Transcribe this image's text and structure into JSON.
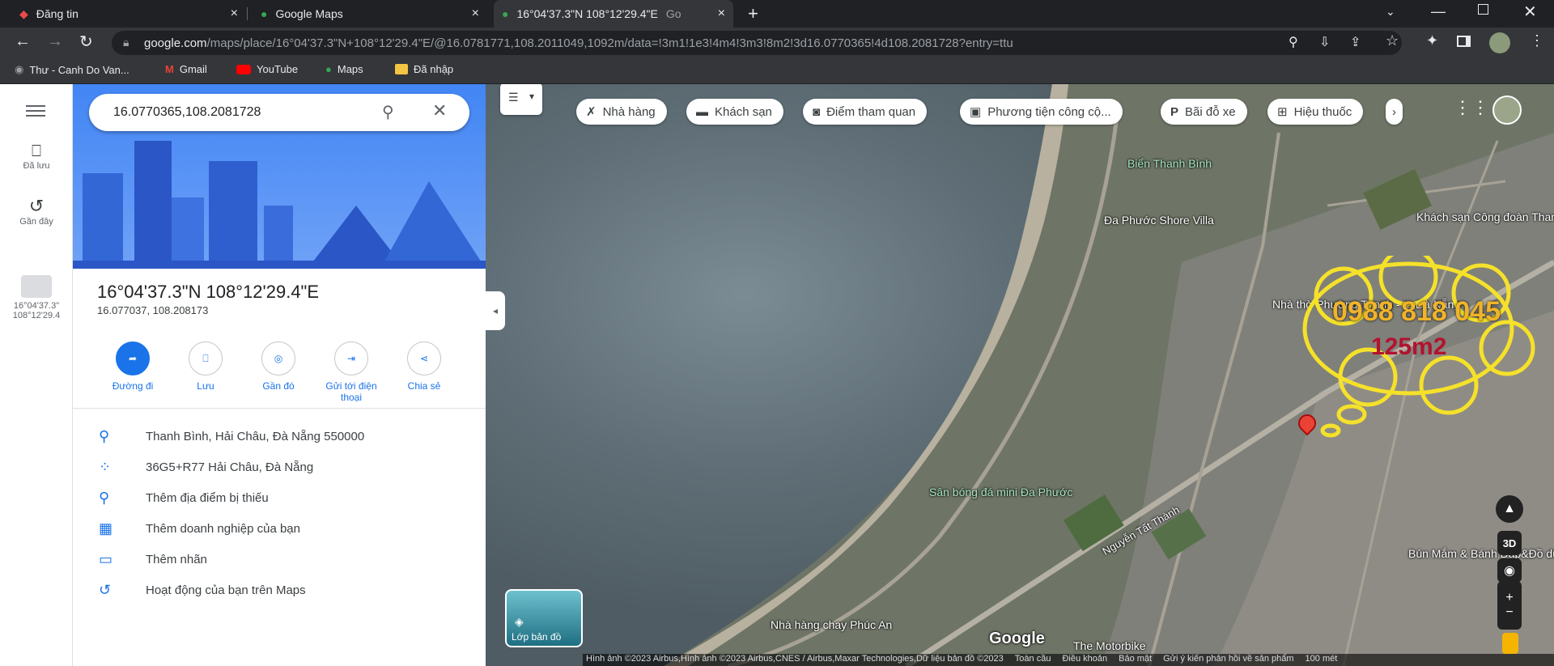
{
  "tabs": [
    {
      "title": "Đăng tin",
      "close": "×"
    },
    {
      "title": "Google Maps",
      "close": "×"
    },
    {
      "title": "16°04'37.3\"N 108°12'29.4\"E",
      "suffix": "Go",
      "close": "×"
    }
  ],
  "new_tab": "+",
  "address_bar": {
    "domain": "google.com",
    "path": "/maps/place/16°04'37.3\"N+108°12'29.4\"E/@16.0781771,108.2011049,1092m/data=!3m1!1e3!4m4!3m3!8m2!3d16.0770365!4d108.2081728?entry=ttu"
  },
  "bookmarks": [
    "Thư - Canh Do Van...",
    "Gmail",
    "YouTube",
    "Maps",
    "Đã nhập"
  ],
  "rail": {
    "saved": "Đã lưu",
    "recent": "Gần đây",
    "recent_place_l1": "16°04'37.3\"",
    "recent_place_l2": "108°12'29.4"
  },
  "search": {
    "value": "16.0770365,108.2081728"
  },
  "place": {
    "title": "16°04'37.3\"N 108°12'29.4\"E",
    "coords": "16.077037, 108.208173"
  },
  "actions": [
    {
      "label": "Đường đi"
    },
    {
      "label": "Lưu"
    },
    {
      "label": "Gần đó"
    },
    {
      "label": "Gửi tới điện thoại"
    },
    {
      "label": "Chia sẻ"
    }
  ],
  "info": [
    {
      "icon": "location-pin-icon",
      "text": "Thanh Bình, Hải Châu, Đà Nẵng 550000"
    },
    {
      "icon": "plus-code-icon",
      "text": "36G5+R77 Hải Châu, Đà Nẵng"
    },
    {
      "icon": "add-place-icon",
      "text": "Thêm địa điểm bị thiếu"
    },
    {
      "icon": "add-business-icon",
      "text": "Thêm doanh nghiệp của bạn"
    },
    {
      "icon": "label-icon",
      "text": "Thêm nhãn"
    },
    {
      "icon": "history-icon",
      "text": "Hoạt động của bạn trên Maps"
    }
  ],
  "chips": [
    "Nhà hàng",
    "Khách sạn",
    "Điểm tham quan",
    "Phương tiện công cộ...",
    "Bãi đỗ xe",
    "Hiệu thuốc"
  ],
  "map_labels": {
    "beach": "Biển Thanh Bình",
    "villa": "Đa Phước Shore Villa",
    "hotel": "Khách sạn Công đoàn Thanh Bình",
    "church": "Nhà thờ Phường Thanh - tp Đà Nẵng",
    "field": "Sân bóng đá mini Đa Phước",
    "street": "Nguyễn Tất Thành",
    "restaurant": "Nhà hàng chay Phúc An",
    "noodle": "Bún Mắm & Bánh Đập&Đồ dữ trộn",
    "motorbike": "The Motorbike",
    "google": "Google"
  },
  "overlay": {
    "phone": "0988 818 045",
    "area": "125m2"
  },
  "layers": {
    "label": "Lớp bản đồ"
  },
  "controls": {
    "three_d": "3D"
  },
  "footer": {
    "attribution": "Hình ảnh ©2023 Airbus,Hình ảnh ©2023 Airbus,CNES / Airbus,Maxar Technologies,Dữ liệu bản đồ ©2023",
    "links": [
      "Toàn cầu",
      "Điều khoản",
      "Bảo mật",
      "Gửi ý kiến phản hồi về sản phẩm"
    ],
    "scale": "100 mét"
  },
  "colors": {
    "accent": "#1a73e8",
    "overlay_text": "#f0b429",
    "overlay_area": "#b3122e",
    "overlay_stroke": "#f5e12a"
  }
}
